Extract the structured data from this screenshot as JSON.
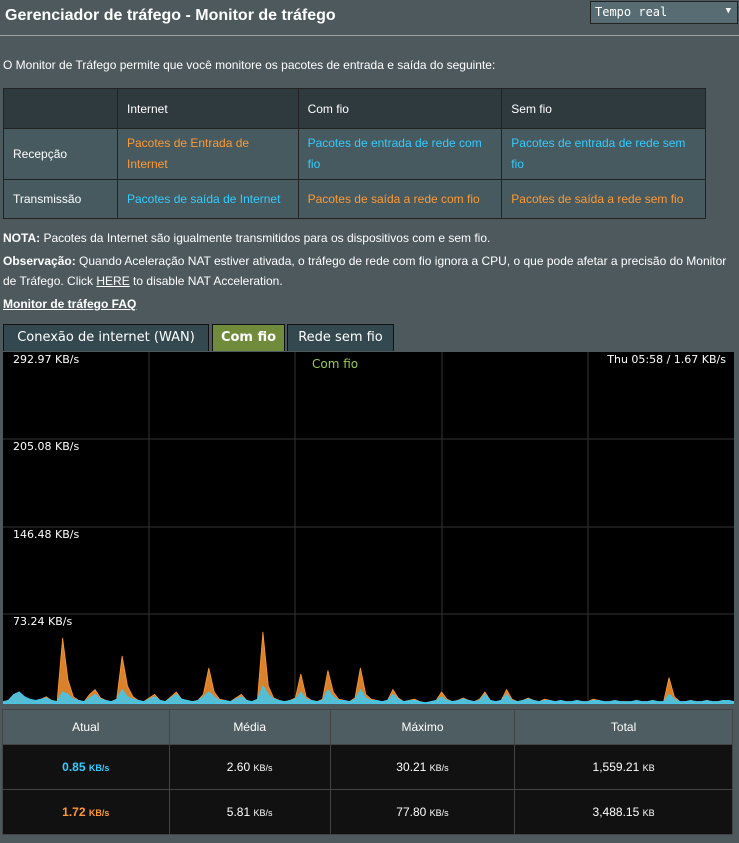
{
  "header": {
    "title": "Gerenciador de tráfego - Monitor de tráfego",
    "mode_select": "Tempo real"
  },
  "intro": "O Monitor de Tráfego permite que você monitore os pacotes de entrada e saída do seguinte:",
  "info_table": {
    "columns": [
      "Internet",
      "Com fio",
      "Sem fio"
    ],
    "rows": [
      {
        "label": "Recepção",
        "cells": [
          "Pacotes de Entrada de Internet",
          "Pacotes de entrada de rede com fio",
          "Pacotes de entrada de rede sem fio"
        ]
      },
      {
        "label": "Transmissão",
        "cells": [
          "Pacotes de saída de Internet",
          "Pacotes de saída a rede com fio",
          "Pacotes de saída a rede sem fio"
        ]
      }
    ]
  },
  "notes": {
    "nota_label": "NOTA:",
    "nota_text": " Pacotes da Internet são igualmente transmitidos para os dispositivos com e sem fio.",
    "obs_label": "Observação:",
    "obs_text1": " Quando Aceleração NAT estiver ativada, o tráfego de rede com fio ignora a CPU, o que pode afetar a precisão do Monitor de Tráfego. Click ",
    "obs_link": "HERE",
    "obs_text2": " to disable NAT Acceleration."
  },
  "faq_link": "Monitor de tráfego FAQ",
  "tabs": [
    {
      "label": "Conexão de internet (WAN)",
      "active": false
    },
    {
      "label": "Com fio",
      "active": true
    },
    {
      "label": "Rede sem fio",
      "active": false
    }
  ],
  "graph": {
    "title": "Com fio",
    "timestamp": "Thu 05:58 / 1.67 KB/s",
    "y_labels": [
      "292.97 KB/s",
      "205.08 KB/s",
      "146.48 KB/s",
      "73.24 KB/s"
    ],
    "colors": {
      "rx": "#33ccff",
      "tx": "#ff9933",
      "grid": "#333333"
    }
  },
  "chart_data": {
    "type": "area",
    "ylim": [
      0,
      292.97
    ],
    "y_ticks": [
      292.97,
      205.08,
      146.48,
      73.24
    ],
    "series": [
      {
        "values": [
          2,
          3,
          8,
          10,
          5,
          3,
          2,
          4,
          6,
          3,
          2,
          55,
          20,
          6,
          3,
          2,
          8,
          12,
          5,
          3,
          2,
          4,
          40,
          15,
          6,
          3,
          2,
          5,
          8,
          3,
          2,
          6,
          10,
          4,
          3,
          2,
          3,
          8,
          30,
          10,
          4,
          3,
          2,
          5,
          8,
          3,
          2,
          4,
          60,
          15,
          5,
          3,
          2,
          3,
          5,
          25,
          6,
          3,
          2,
          4,
          28,
          10,
          4,
          3,
          2,
          5,
          30,
          8,
          4,
          3,
          2,
          3,
          12,
          5,
          2,
          3,
          4,
          2,
          1,
          2,
          3,
          10,
          4,
          2,
          3,
          5,
          3,
          2,
          4,
          10,
          3,
          2,
          3,
          12,
          4,
          2,
          3,
          5,
          3,
          2,
          4,
          3,
          2,
          3,
          2,
          2,
          3,
          2,
          2,
          4,
          3,
          2,
          2,
          3,
          2,
          2,
          2,
          3,
          2,
          2,
          3,
          2,
          2,
          22,
          6,
          2,
          2,
          3,
          2,
          2,
          3,
          2,
          2,
          3,
          3,
          2
        ]
      },
      {
        "values": [
          2,
          3,
          8,
          10,
          6,
          4,
          3,
          4,
          5,
          3,
          2,
          10,
          8,
          4,
          3,
          2,
          5,
          8,
          4,
          3,
          2,
          4,
          12,
          6,
          4,
          3,
          2,
          4,
          6,
          3,
          2,
          5,
          8,
          4,
          3,
          2,
          3,
          6,
          10,
          6,
          3,
          3,
          2,
          4,
          6,
          3,
          2,
          4,
          15,
          8,
          4,
          3,
          2,
          3,
          4,
          10,
          4,
          3,
          2,
          3,
          12,
          6,
          3,
          3,
          2,
          4,
          12,
          5,
          3,
          3,
          2,
          3,
          8,
          4,
          2,
          3,
          3,
          2,
          1,
          2,
          3,
          6,
          3,
          2,
          3,
          4,
          3,
          2,
          3,
          8,
          3,
          2,
          3,
          8,
          3,
          2,
          3,
          4,
          3,
          2,
          3,
          3,
          2,
          3,
          2,
          2,
          3,
          2,
          2,
          3,
          3,
          2,
          2,
          3,
          2,
          2,
          2,
          3,
          2,
          2,
          3,
          2,
          2,
          8,
          4,
          2,
          2,
          3,
          2,
          2,
          3,
          2,
          2,
          3,
          3,
          2
        ]
      }
    ]
  },
  "stats": {
    "headers": [
      "Atual",
      "Média",
      "Máximo",
      "Total"
    ],
    "rows": [
      {
        "current": "0.85",
        "avg": "2.60",
        "max": "30.21",
        "total": "1,559.21",
        "unit_rate": "KB/s",
        "unit_total": "KB"
      },
      {
        "current": "1.72",
        "avg": "5.81",
        "max": "77.80",
        "total": "3,488.15",
        "unit_rate": "KB/s",
        "unit_total": "KB"
      }
    ]
  }
}
